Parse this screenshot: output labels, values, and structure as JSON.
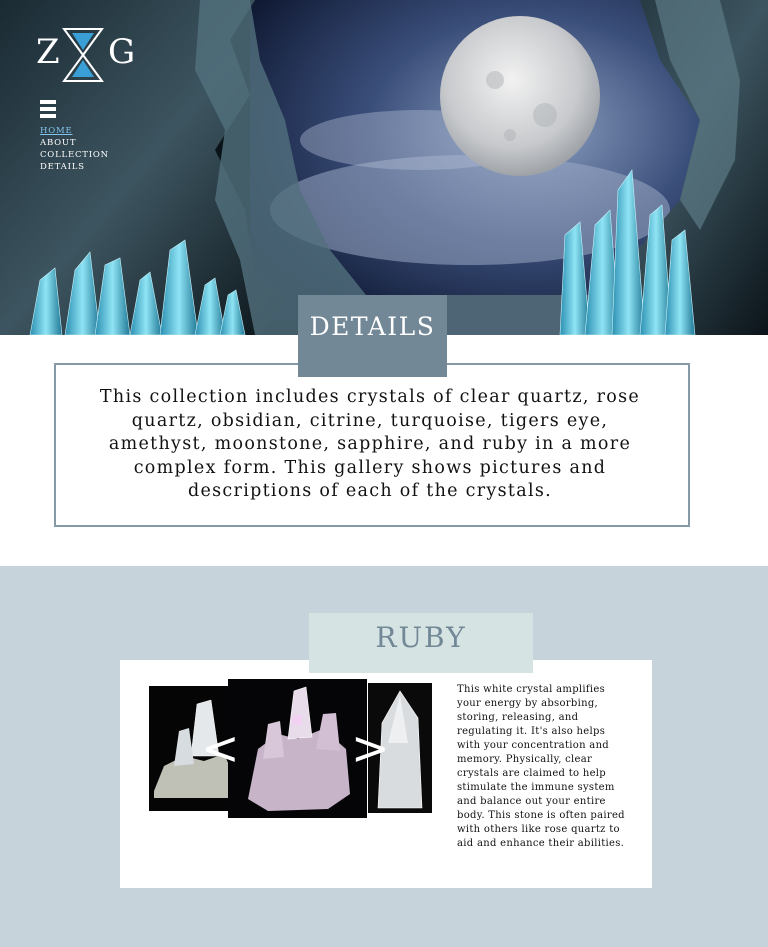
{
  "brand": {
    "logo_left": "Z",
    "logo_right": "G"
  },
  "nav": {
    "items": [
      {
        "label": "HOME",
        "active": true
      },
      {
        "label": "ABOUT",
        "active": false
      },
      {
        "label": "COLLECTION",
        "active": false
      },
      {
        "label": "DETAILS",
        "active": false
      }
    ]
  },
  "details": {
    "title": "DETAILS",
    "body": "This collection includes crystals of clear quartz, rose quartz, obsidian, citrine, turquoise, tigers eye, amethyst, moonstone, sapphire, and ruby in a more complex form. This gallery shows pictures and descriptions of each of the crystals."
  },
  "ruby": {
    "title": "RUBY",
    "prev_label": "<",
    "next_label": ">",
    "description": "This white crystal amplifies your energy by absorbing, storing, releasing, and regulating it. It's also helps with your concentration and memory. Physically, clear crystals are claimed to help stimulate the immune system and balance out your entire body. This stone is often paired with others like rose quartz to aid and enhance their abilities."
  },
  "colors": {
    "accent_slate": "#728896",
    "section_bg": "#c6d3da",
    "ruby_title_bg": "#d5e3e3",
    "nav_active": "#7fc4ec",
    "crystal_teal": "#4fb6d3"
  }
}
